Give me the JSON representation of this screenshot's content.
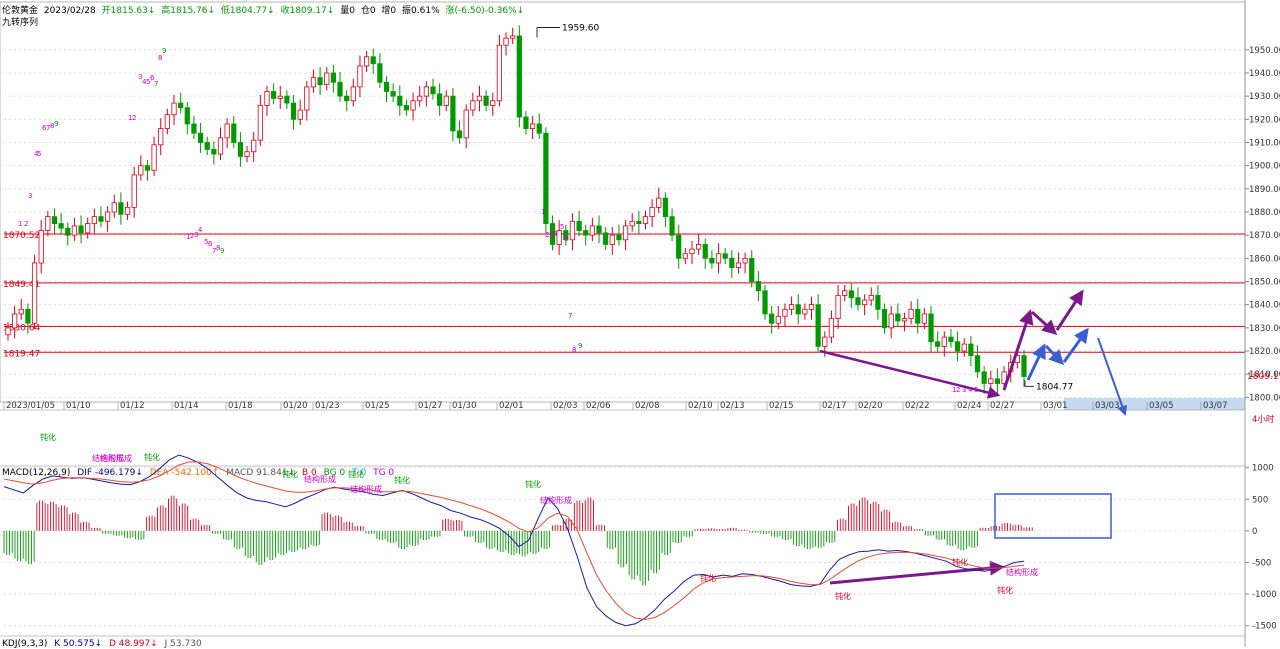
{
  "header": {
    "instrument": "伦敦黄金",
    "date": "2023/02/28",
    "open": "开1815.63↓",
    "high": "高1815.76↓",
    "low": "低1804.77↓",
    "close": "收1809.17↓",
    "volume": "量0",
    "position": "仓0",
    "increase": "增0",
    "amplitude": "振0.61%",
    "change": "涨(-6.50)-0.36%↓"
  },
  "indicator_label": "九转序列",
  "macd_header": {
    "name": "MACD(12,26,9)",
    "dif": "DIF -496.179↓",
    "dea": "DEA -542.100↑",
    "macd": "MACD 91.841↓",
    "b": "B 0",
    "bg": "BG 0",
    "t": "T 0",
    "tg": "TG 0"
  },
  "kdj_header": {
    "name": "KDJ(9,3,3)",
    "k": "K 50.575↓",
    "d": "D 48.997↓",
    "j": "J 53.730"
  },
  "period_label": "4小时",
  "colors": {
    "up": "#e0001b",
    "down": "#009a00",
    "level_line": "#e0001b",
    "dif_line": "#1a1aa0",
    "dea_line": "#e0503a",
    "purple_arrow": "#7a1a8a",
    "blue_arrow": "#3a5fd0",
    "future_band": "#c5d9f1"
  },
  "chart_data": [
    {
      "type": "candlestick",
      "title": "",
      "ylim": [
        1798,
        1962
      ],
      "y_ticks": [
        1800,
        1810,
        1820,
        1830,
        1840,
        1850,
        1860,
        1870,
        1880,
        1890,
        1900,
        1910,
        1920,
        1930,
        1940,
        1950
      ],
      "x_tick_labels": [
        "2023/01/05",
        "01/10",
        "01/12",
        "01/14",
        "01/18",
        "01/20",
        "01/23",
        "01/25",
        "01/27",
        "01/30",
        "02/01",
        "02/03",
        "02/06",
        "02/08",
        "02/10",
        "02/13",
        "02/15",
        "02/17",
        "02/20",
        "02/22",
        "02/24",
        "02/27",
        "03/01",
        "03/03",
        "03/05",
        "03/07"
      ],
      "horizontal_levels": [
        {
          "value": 1870.52,
          "label": "1870.52"
        },
        {
          "value": 1849.41,
          "label": "1849.41"
        },
        {
          "value": 1830.64,
          "label": "1830.64"
        },
        {
          "value": 1819.47,
          "label": "1819.47"
        }
      ],
      "annotations": [
        {
          "label": "1959.60",
          "value": 1959.6
        },
        {
          "label": "1804.77",
          "value": 1804.77
        }
      ],
      "last_price": "1809.17",
      "td_sequential_labels": [
        "1",
        "2",
        "3",
        "4",
        "5",
        "6",
        "7",
        "8",
        "9"
      ],
      "closes": [
        1830,
        1836,
        1838,
        1832,
        1858,
        1872,
        1878,
        1875,
        1873,
        1870,
        1874,
        1871,
        1875,
        1878,
        1876,
        1880,
        1884,
        1879,
        1882,
        1896,
        1900,
        1898,
        1909,
        1916,
        1922,
        1927,
        1925,
        1918,
        1914,
        1910,
        1907,
        1905,
        1912,
        1918,
        1910,
        1904,
        1906,
        1911,
        1926,
        1932,
        1929,
        1930,
        1927,
        1920,
        1924,
        1934,
        1938,
        1935,
        1940,
        1936,
        1930,
        1928,
        1934,
        1943,
        1947,
        1944,
        1936,
        1932,
        1930,
        1926,
        1924,
        1928,
        1930,
        1934,
        1931,
        1926,
        1930,
        1915,
        1912,
        1924,
        1928,
        1930,
        1926,
        1928,
        1952,
        1955,
        1956,
        1921,
        1916,
        1918,
        1914,
        1875,
        1866,
        1872,
        1868,
        1876,
        1872,
        1870,
        1874,
        1871,
        1866,
        1870,
        1868,
        1874,
        1876,
        1875,
        1878,
        1882,
        1886,
        1878,
        1870,
        1860,
        1862,
        1864,
        1866,
        1860,
        1858,
        1862,
        1860,
        1856,
        1858,
        1860,
        1850,
        1846,
        1836,
        1832,
        1835,
        1838,
        1840,
        1836,
        1838,
        1840,
        1822,
        1826,
        1834,
        1844,
        1846,
        1843,
        1840,
        1842,
        1844,
        1838,
        1830,
        1836,
        1833,
        1834,
        1838,
        1832,
        1836,
        1824,
        1822,
        1826,
        1824,
        1820,
        1823,
        1818,
        1811,
        1806,
        1808,
        1806,
        1811,
        1815,
        1818,
        1809
      ]
    },
    {
      "type": "bar+line",
      "title": "MACD(12,26,9)",
      "ylim": [
        -1600,
        1200
      ],
      "y_ticks": [
        -1500,
        -1000,
        -500,
        0,
        500,
        1000
      ],
      "series": [
        {
          "name": "DIF",
          "values": [
            700,
            650,
            600,
            720,
            820,
            870,
            850,
            830,
            840,
            820,
            790,
            760,
            740,
            730,
            780,
            860,
            980,
            1120,
            1200,
            1150,
            1080,
            980,
            850,
            720,
            600,
            520,
            480,
            460,
            420,
            380,
            440,
            520,
            580,
            650,
            690,
            660,
            640,
            620,
            580,
            560,
            600,
            640,
            590,
            520,
            450,
            400,
            320,
            280,
            220,
            180,
            120,
            40,
            -80,
            -250,
            -150,
            200,
            520,
            350,
            40,
            -400,
            -900,
            -1200,
            -1350,
            -1450,
            -1500,
            -1470,
            -1380,
            -1250,
            -1080,
            -950,
            -800,
            -700,
            -690,
            -730,
            -700,
            -720,
            -680,
            -690,
            -720,
            -760,
            -800,
            -850,
            -870,
            -880,
            -840,
            -620,
            -450,
            -380,
            -330,
            -320,
            -300,
            -320,
            -310,
            -330,
            -360,
            -400,
            -440,
            -480,
            -560,
            -600,
            -620,
            -640,
            -600,
            -560,
            -500,
            -480
          ]
        },
        {
          "name": "DEA",
          "values": [
            820,
            790,
            760,
            740,
            760,
            800,
            830,
            840,
            840,
            830,
            820,
            800,
            780,
            770,
            780,
            810,
            870,
            950,
            1040,
            1090,
            1090,
            1060,
            1000,
            930,
            860,
            800,
            750,
            710,
            670,
            630,
            610,
            610,
            630,
            660,
            680,
            680,
            670,
            660,
            640,
            620,
            620,
            630,
            620,
            590,
            560,
            530,
            490,
            450,
            400,
            350,
            290,
            220,
            140,
            40,
            -20,
            50,
            200,
            280,
            230,
            20,
            -350,
            -700,
            -950,
            -1150,
            -1300,
            -1380,
            -1400,
            -1370,
            -1290,
            -1180,
            -1060,
            -920,
            -820,
            -760,
            -740,
            -730,
            -720,
            -710,
            -710,
            -730,
            -760,
            -800,
            -830,
            -850,
            -850,
            -770,
            -660,
            -560,
            -470,
            -410,
            -370,
            -350,
            -340,
            -340,
            -350,
            -370,
            -400,
            -430,
            -480,
            -520,
            -560,
            -590,
            -590,
            -580,
            -560,
            -542
          ]
        },
        {
          "name": "MACD",
          "values": [
            -400,
            -500,
            -550,
            500,
            480,
            420,
            300,
            150,
            50,
            -50,
            -80,
            -120,
            -150,
            250,
            420,
            580,
            450,
            200,
            100,
            -50,
            -150,
            -300,
            -450,
            -560,
            -480,
            -400,
            -350,
            -300,
            -250,
            300,
            250,
            150,
            80,
            -50,
            -150,
            -200,
            -300,
            -250,
            -150,
            -100,
            200,
            180,
            -100,
            -200,
            -300,
            -350,
            -400,
            -420,
            -380,
            -300,
            100,
            200,
            500,
            550,
            100,
            -300,
            -600,
            -800,
            -900,
            -700,
            -400,
            -200,
            -100,
            30,
            40,
            30,
            50,
            20,
            -30,
            -50,
            -100,
            -150,
            -250,
            -300,
            -280,
            -200,
            200,
            450,
            550,
            480,
            350,
            150,
            80,
            30,
            -80,
            -150,
            -250,
            -320,
            -280,
            50,
            80,
            130,
            100,
            60
          ]
        }
      ],
      "labels": [
        "钝化",
        "结构形成",
        "钝化",
        "结构形成",
        "钝化",
        "钝化",
        "结构形成",
        "钝化",
        "结构形成",
        "钝化",
        "钝化",
        "结构形成",
        "钝化",
        "钝化",
        "结构形成",
        "钝化"
      ]
    }
  ]
}
